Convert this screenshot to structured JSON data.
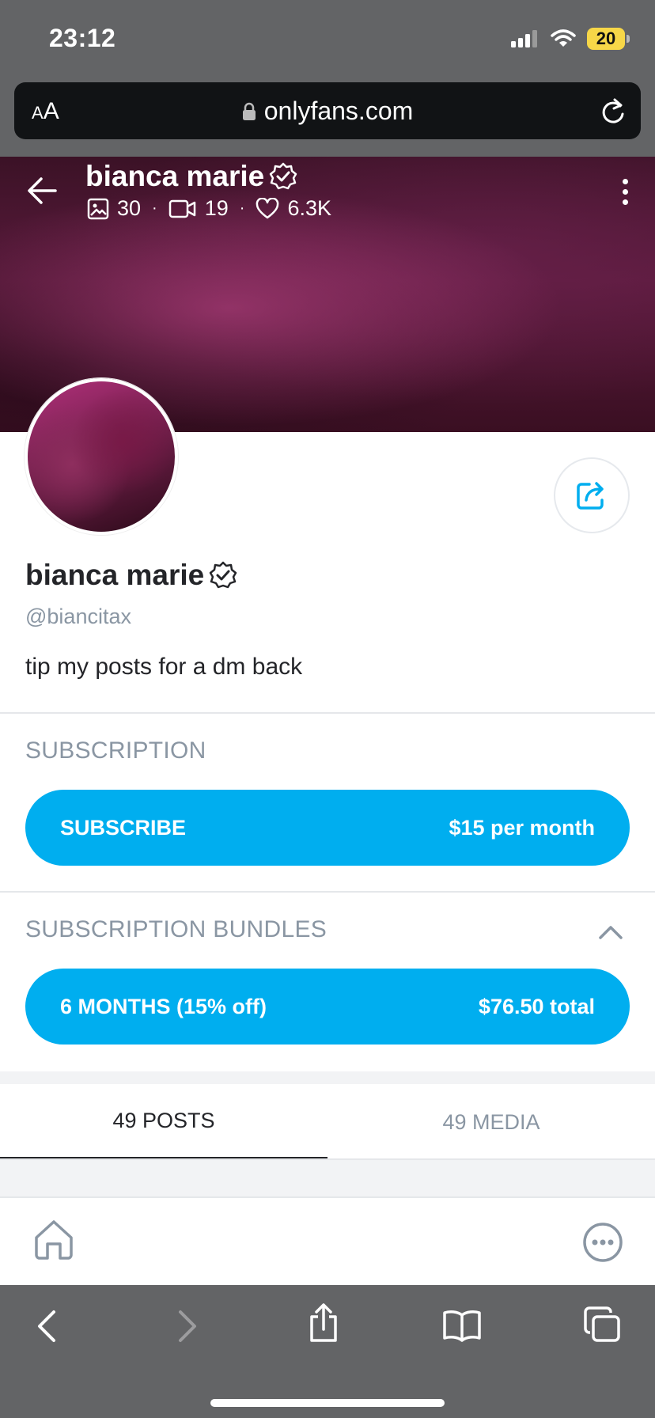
{
  "status_bar": {
    "time": "23:12",
    "battery": "20"
  },
  "browser": {
    "text_size_small": "A",
    "text_size_large": "A",
    "url": "onlyfans.com"
  },
  "cover": {
    "name": "bianca marie",
    "stats": {
      "photos": "30",
      "videos": "19",
      "likes": "6.3K"
    },
    "separator": "·"
  },
  "profile": {
    "name": "bianca marie",
    "handle": "@biancitax",
    "bio": "tip my posts for a dm back"
  },
  "subscription": {
    "title": "SUBSCRIPTION",
    "button_label": "SUBSCRIBE",
    "button_price": "$15 per month"
  },
  "bundles": {
    "title": "SUBSCRIPTION BUNDLES",
    "items": [
      {
        "label": "6 MONTHS (15% off)",
        "price": "$76.50 total"
      }
    ]
  },
  "tabs": [
    {
      "label": "49 POSTS",
      "active": true
    },
    {
      "label": "49 MEDIA",
      "active": false
    }
  ],
  "colors": {
    "accent": "#00aeef",
    "muted_text": "#8a96a3",
    "primary_text": "#242529",
    "browser_chrome": "#636466",
    "battery": "#f7d748"
  },
  "icons": {
    "back": "back-arrow-icon",
    "verified": "verified-badge-icon",
    "photo": "image-icon",
    "video": "video-icon",
    "heart": "heart-icon",
    "more": "more-vertical-icon",
    "share": "share-icon",
    "collapse": "chevron-up-icon",
    "home": "home-icon",
    "app_more": "more-circle-icon",
    "lock": "lock-icon",
    "reload": "reload-icon",
    "signal": "signal-icon",
    "wifi": "wifi-icon"
  }
}
